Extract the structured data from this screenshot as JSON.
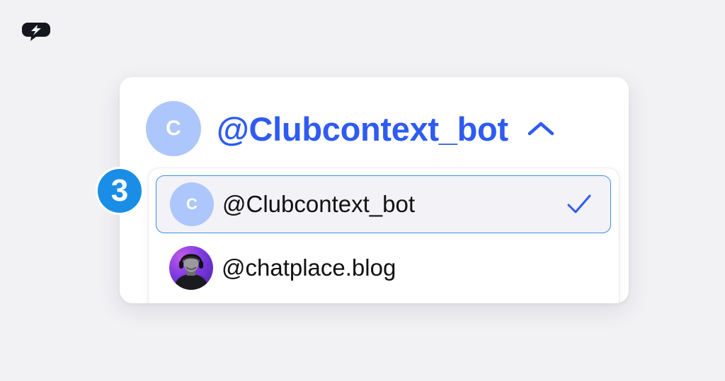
{
  "account_selector": {
    "current_avatar_letter": "C",
    "current_account": "@Clubcontext_bot",
    "accent_color": "#2f5bf1",
    "expanded_icon": "chevron-up-icon"
  },
  "dropdown": {
    "options": [
      {
        "avatar_letter": "C",
        "label": "@Clubcontext_bot",
        "selected": true,
        "icon": "checkmark-icon"
      },
      {
        "avatar": "profile-photo",
        "label": "@chatplace.blog",
        "selected": false
      }
    ]
  },
  "step_badge": {
    "number": "3",
    "color": "#1a8ee6"
  },
  "colors": {
    "avatar_bg": "#adc6fb",
    "selected_border": "#3d8fe0",
    "background": "#f2f2f5"
  }
}
